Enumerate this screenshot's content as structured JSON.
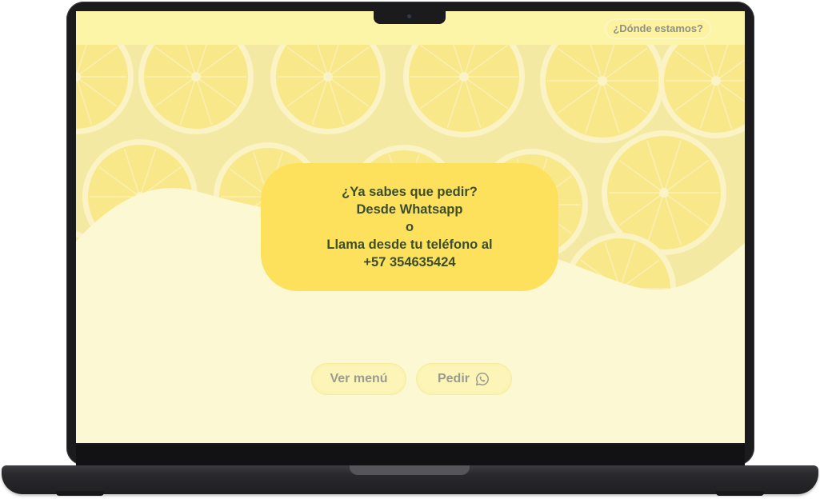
{
  "header": {
    "where_label": "¿Dónde estamos?"
  },
  "hero": {
    "background": "lemon-slices-pattern",
    "card": {
      "line1": "¿Ya sabes que pedir?",
      "line2": "Desde Whatsapp",
      "line3": "o",
      "line4": "Llama desde tu teléfono al",
      "phone": "+57 354635424"
    }
  },
  "actions": {
    "menu_label": "Ver menú",
    "order_label": "Pedir",
    "order_icon": "whatsapp-icon"
  },
  "colors": {
    "page_background": "#fdf8d4",
    "header_background": "#fcf4a6",
    "card_background": "#fde15c",
    "card_text": "#3c4d2e",
    "button_text": "#9a9b90",
    "lemon_flesh": "#f8e88a",
    "lemon_rind": "#fbf3c6"
  }
}
